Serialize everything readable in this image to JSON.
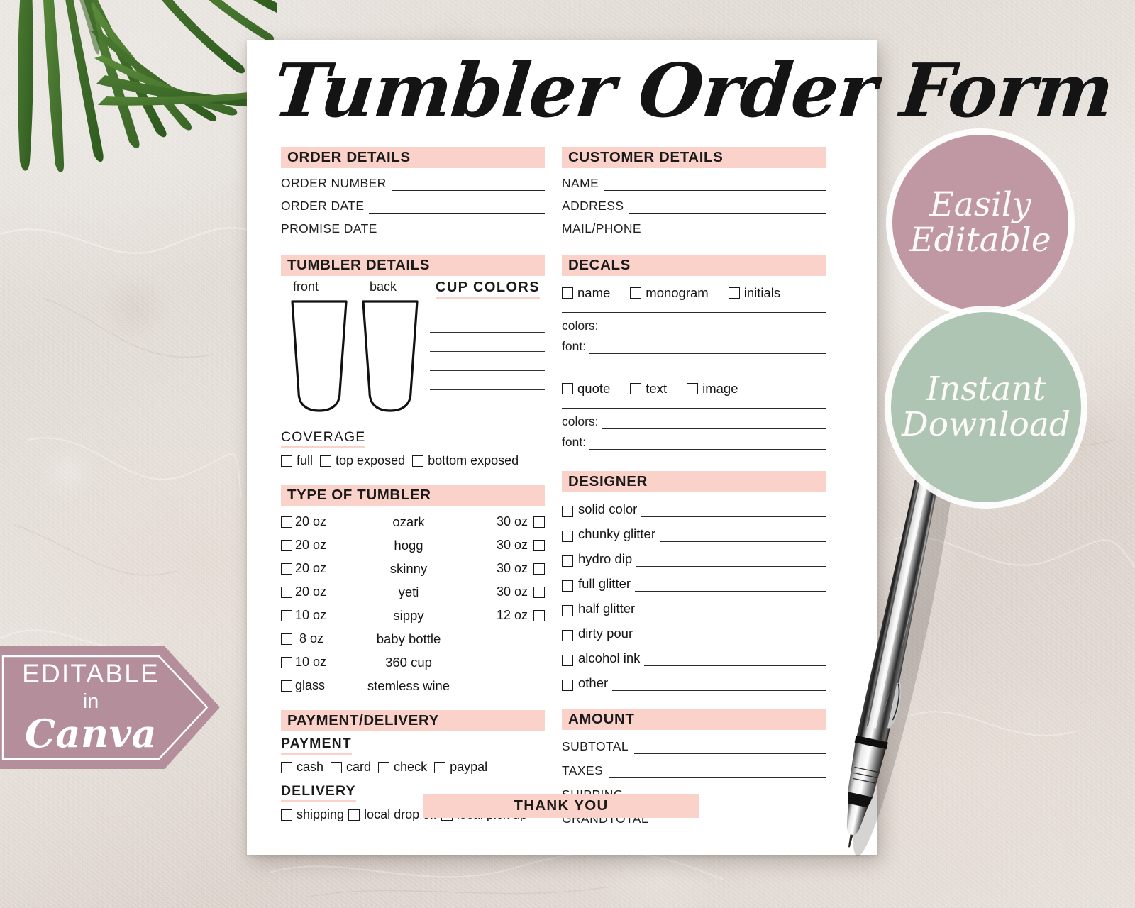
{
  "page": {
    "title": "Tumbler Order Form"
  },
  "order_details": {
    "heading": "ORDER DETAILS",
    "fields": [
      {
        "label": "ORDER NUMBER",
        "value": ""
      },
      {
        "label": "ORDER DATE",
        "value": ""
      },
      {
        "label": "PROMISE DATE",
        "value": ""
      }
    ]
  },
  "customer_details": {
    "heading": "CUSTOMER DETAILS",
    "fields": [
      {
        "label": "NAME",
        "value": ""
      },
      {
        "label": "ADDRESS",
        "value": ""
      },
      {
        "label": "MAIL/PHONE",
        "value": ""
      }
    ]
  },
  "tumbler_details": {
    "heading": "TUMBLER DETAILS",
    "front_caption": "front",
    "back_caption": "back",
    "cup_colors_heading": "CUP COLORS",
    "cup_colors_line_count": 6,
    "coverage": {
      "heading": "COVERAGE",
      "options": [
        {
          "label": "full",
          "checked": false
        },
        {
          "label": "top exposed",
          "checked": false
        },
        {
          "label": "bottom exposed",
          "checked": false
        }
      ]
    }
  },
  "decals": {
    "heading": "DECALS",
    "group1": [
      {
        "label": "name",
        "checked": false
      },
      {
        "label": "monogram",
        "checked": false
      },
      {
        "label": "initials",
        "checked": false
      }
    ],
    "group1_fields": [
      {
        "label": "colors:",
        "value": ""
      },
      {
        "label": "font:",
        "value": ""
      }
    ],
    "group2": [
      {
        "label": "quote",
        "checked": false
      },
      {
        "label": "text",
        "checked": false
      },
      {
        "label": "image",
        "checked": false
      }
    ],
    "group2_fields": [
      {
        "label": "colors:",
        "value": ""
      },
      {
        "label": "font:",
        "value": ""
      }
    ]
  },
  "type_of_tumbler": {
    "heading": "TYPE OF TUMBLER",
    "rows": [
      {
        "left_size": "20 oz",
        "left_checked": false,
        "name": "ozark",
        "right_size": "30 oz",
        "right_checked": false
      },
      {
        "left_size": "20 oz",
        "left_checked": false,
        "name": "hogg",
        "right_size": "30 oz",
        "right_checked": false
      },
      {
        "left_size": "20 oz",
        "left_checked": false,
        "name": "skinny",
        "right_size": "30 oz",
        "right_checked": false
      },
      {
        "left_size": "20 oz",
        "left_checked": false,
        "name": "yeti",
        "right_size": "30 oz",
        "right_checked": false
      },
      {
        "left_size": "10 oz",
        "left_checked": false,
        "name": "sippy",
        "right_size": "12 oz",
        "right_checked": false
      },
      {
        "left_size": "8 oz",
        "left_checked": false,
        "name": "baby bottle",
        "right_size": "",
        "right_checked": false
      },
      {
        "left_size": "10 oz",
        "left_checked": false,
        "name": "360 cup",
        "right_size": "",
        "right_checked": false
      },
      {
        "left_size": "glass",
        "left_checked": false,
        "name": "stemless wine",
        "right_size": "",
        "right_checked": false
      }
    ]
  },
  "designer": {
    "heading": "DESIGNER",
    "options": [
      {
        "label": "solid color",
        "checked": false,
        "value": ""
      },
      {
        "label": "chunky glitter",
        "checked": false,
        "value": ""
      },
      {
        "label": "hydro dip",
        "checked": false,
        "value": ""
      },
      {
        "label": "full glitter",
        "checked": false,
        "value": ""
      },
      {
        "label": "half glitter",
        "checked": false,
        "value": ""
      },
      {
        "label": "dirty pour",
        "checked": false,
        "value": ""
      },
      {
        "label": "alcohol ink",
        "checked": false,
        "value": ""
      },
      {
        "label": "other",
        "checked": false,
        "value": ""
      }
    ]
  },
  "payment_delivery": {
    "heading": "PAYMENT/DELIVERY",
    "payment_heading": "PAYMENT",
    "payment_options": [
      {
        "label": "cash",
        "checked": false
      },
      {
        "label": "card",
        "checked": false
      },
      {
        "label": "check",
        "checked": false
      },
      {
        "label": "paypal",
        "checked": false
      }
    ],
    "delivery_heading": "DELIVERY",
    "delivery_options": [
      {
        "label": "shipping",
        "checked": false
      },
      {
        "label": "local drop off",
        "checked": false
      },
      {
        "label": "local pick up",
        "checked": false
      }
    ]
  },
  "amount": {
    "heading": "AMOUNT",
    "rows": [
      {
        "label": "SUBTOTAL",
        "value": ""
      },
      {
        "label": "TAXES",
        "value": ""
      },
      {
        "label": "SHIPPING",
        "value": ""
      },
      {
        "label": "GRANDTOTAL",
        "value": ""
      }
    ]
  },
  "footer": {
    "thank_you": "THANK YOU"
  },
  "badges": {
    "editable": {
      "line1": "Easily",
      "line2": "Editable",
      "color": "#bf98a4"
    },
    "instant": {
      "line1": "Instant",
      "line2": "Download",
      "color": "#afc5b4"
    }
  },
  "canva_banner": {
    "line1": "EDITABLE",
    "line2": "in",
    "line3": "Canva",
    "color": "#b58e9c"
  },
  "colors": {
    "accent_pink": "#fbd2c9",
    "ink": "#1a1a1a",
    "paper": "#ffffff"
  }
}
